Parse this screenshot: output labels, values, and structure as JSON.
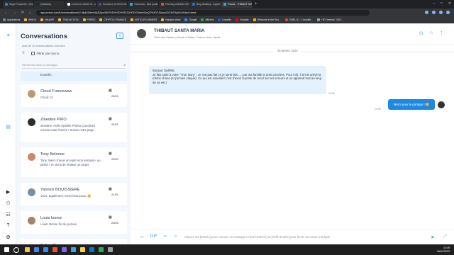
{
  "browser": {
    "tabs": [
      {
        "label": "Stiga Prospectie | Tout savoir s",
        "color": "#1e88e5"
      },
      {
        "label": "(Waalaxy)",
        "color": "#0d2b57"
      },
      {
        "label": "Comment utiliser M...ou Whiz",
        "color": "#ffffff"
      },
      {
        "label": "Sumbas | ACCESS de ANNEES",
        "color": "#5a3ea8"
      },
      {
        "label": "Tochanda - Mes publications",
        "color": "#3da4e8"
      },
      {
        "label": "Planning éditorial 2023 - Wha",
        "color": "#e94f35"
      },
      {
        "label": "Blog Waalaxy - Apprenez tout",
        "color": "#2b6bd6"
      },
      {
        "label": "Pewas · THIBAUT SANTA MAR",
        "color": "#3da4e8",
        "active": true
      }
    ],
    "new_tab": "+",
    "window_controls": [
      "–",
      "□",
      "✕"
    ],
    "nav": [
      "←",
      "→",
      "⟳",
      "⌂"
    ],
    "url": "app.pewas.com/fr/conversations/c2-4kj4L6MmHAjZjZgz%3D%3D%3D%3DOQ%3DOOdmNZaQZ%3DZJMjoaUZ0ONTkyZeJtXdm4=false",
    "bookmarks": [
      {
        "label": "Applications",
        "color": "#7b8794"
      },
      {
        "label": "BINGO",
        "color": "#e8b34a"
      },
      {
        "label": "WAAAP!",
        "color": "#e8b34a"
      },
      {
        "label": "TRADUCTION",
        "color": "#e8b34a"
      },
      {
        "label": "PERSO",
        "color": "#e8b34a"
      },
      {
        "label": "CRYPTO / FINANCE",
        "color": "#e8b34a"
      },
      {
        "label": "ARTICLES ANNEES",
        "color": "#e8b34a"
      },
      {
        "label": "Banque photo",
        "color": "#e8b34a"
      },
      {
        "label": "Google",
        "color": "#4285f4"
      },
      {
        "label": "Affiches",
        "color": "#34a853"
      },
      {
        "label": "LinkedIn",
        "color": "#0a66c2"
      },
      {
        "label": "Youtube",
        "color": "#ff0000"
      },
      {
        "label": "Welcome to the Sun...",
        "color": "#f4b400"
      },
      {
        "label": "EMELLO - L'actualit...",
        "color": "#db4437"
      },
      {
        "label": "+30 \"memes\" 2017...",
        "color": "#9aa0a6"
      }
    ]
  },
  "sidebar_rail": {
    "icons": [
      "logo-icon",
      "chat-icon",
      "play-icon",
      "users-icon",
      "question-icon",
      "gear-icon"
    ]
  },
  "conversations": {
    "title": "Conversations",
    "new_button": "+",
    "subtitle": "plus de 10 conversations non lues",
    "filter_label": "Filtrer par non lu",
    "search_placeholder": "Recherche dans un message...",
    "items": [
      {
        "name": "",
        "preview": "bouteille.",
        "date": "",
        "avatar_color": "#cccccc",
        "highlight": true
      },
      {
        "name": "Cloud Francewaa",
        "preview": "Cloud: lol",
        "date": "24/01",
        "avatar_color": "#b99a6f"
      },
      {
        "name": "Zinedine PIRO",
        "preview": "Zinedine: Hello Ophélie Phénix Concilium recrute toute l'année ! Suivez notre page",
        "date": "24/01",
        "avatar_color": "#2e2e2e"
      },
      {
        "name": "Tony Belnoue",
        "preview": "Tony: Merci d'avoir accepté mon invitation, au plaisir ! Je viens de réaliser un projet",
        "date": "23/01",
        "avatar_color": "#c98a6a"
      },
      {
        "name": "Yannick BOUISSIERE",
        "preview": "Vous: Egalement, merci beaucoup. 😊",
        "date": "21/01",
        "avatar_color": "#7a8fa3"
      },
      {
        "name": "Louis Isorez",
        "preview": "Louis: Bonne fin de journée",
        "date": "20/01",
        "avatar_color": "#a3866a"
      },
      {
        "name": "Esther Tronc",
        "preview": "",
        "date": "",
        "avatar_color": "#caa98a"
      }
    ]
  },
  "chat": {
    "contact_name": "THIBAUT SANTA MARIA",
    "contact_subtitle": "Chef des Ventes | Head of Sales, France chez Upclit",
    "day_label": "25 janvier 2023",
    "incoming": {
      "text": "Bonjour Ophélie,\nJe fais suite à votre \"True story\" ; Je n'ai pas fait ce je serai fais .... par ma famille et amis proches. Pour info, il m'est arrivé la même chose (et j'ai bien claqué). Ce qui est essentiel c'est d'avoir la prise de recul sur ses erreurs et un apprend tout au long de sa vie:)",
      "time": "10:30"
    },
    "outgoing": {
      "text": "Merci pour le partage ! 😊",
      "time": "10:30"
    },
    "composer_placeholder": "Cliquez sur [Entrée] pour envoyer ce message et [Ctrl+Entrée] ou [Shift+Entrée] pour forcer un retour à la ligne"
  },
  "taskbar": {
    "time": "13:49",
    "date": "26/01/2023",
    "apps": [
      "#f2c94c",
      "#4285f4",
      "#2d8cff",
      "#e94f35",
      "#7b68ee",
      "#3da4e8",
      "#ffd23f",
      "#0078d4",
      "#34a853",
      "#9aa0a6"
    ]
  }
}
